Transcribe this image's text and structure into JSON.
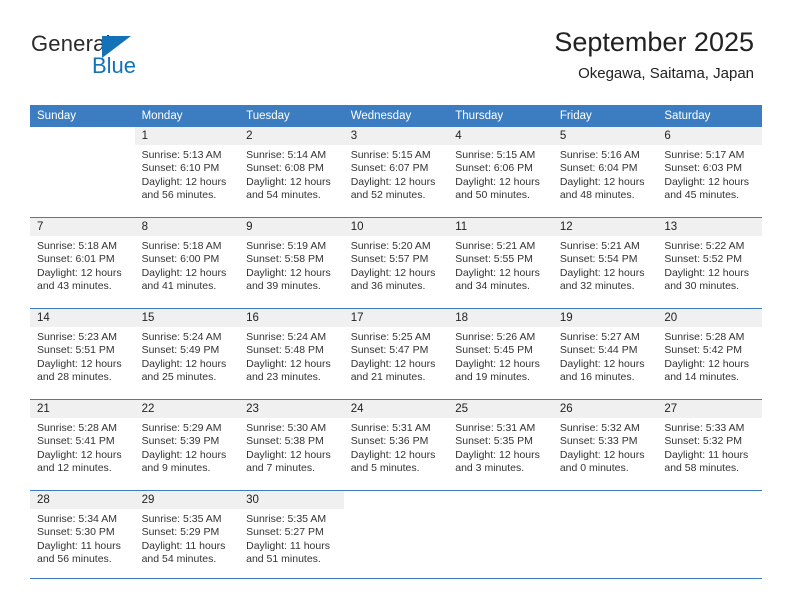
{
  "brand": {
    "name_top": "General",
    "name_bottom": "Blue",
    "triangle_icon": "triangle-icon",
    "color_dark": "#2b2b2b",
    "color_blue": "#1473b8"
  },
  "header": {
    "title": "September 2025",
    "subtitle": "Okegawa, Saitama, Japan"
  },
  "theme": {
    "header_row_bg": "#3b7dc0",
    "header_row_text": "#ffffff",
    "daynum_bg": "#f0f0f0",
    "grid_line": "#3b7dc0",
    "body_text": "#333333"
  },
  "weekdays": [
    "Sunday",
    "Monday",
    "Tuesday",
    "Wednesday",
    "Thursday",
    "Friday",
    "Saturday"
  ],
  "weeks": [
    [
      {
        "day": "",
        "empty": true,
        "sunrise": "",
        "sunset": "",
        "daylight_line1": "",
        "daylight_line2": ""
      },
      {
        "day": "1",
        "sunrise": "Sunrise: 5:13 AM",
        "sunset": "Sunset: 6:10 PM",
        "daylight_line1": "Daylight: 12 hours",
        "daylight_line2": "and 56 minutes."
      },
      {
        "day": "2",
        "sunrise": "Sunrise: 5:14 AM",
        "sunset": "Sunset: 6:08 PM",
        "daylight_line1": "Daylight: 12 hours",
        "daylight_line2": "and 54 minutes."
      },
      {
        "day": "3",
        "sunrise": "Sunrise: 5:15 AM",
        "sunset": "Sunset: 6:07 PM",
        "daylight_line1": "Daylight: 12 hours",
        "daylight_line2": "and 52 minutes."
      },
      {
        "day": "4",
        "sunrise": "Sunrise: 5:15 AM",
        "sunset": "Sunset: 6:06 PM",
        "daylight_line1": "Daylight: 12 hours",
        "daylight_line2": "and 50 minutes."
      },
      {
        "day": "5",
        "sunrise": "Sunrise: 5:16 AM",
        "sunset": "Sunset: 6:04 PM",
        "daylight_line1": "Daylight: 12 hours",
        "daylight_line2": "and 48 minutes."
      },
      {
        "day": "6",
        "sunrise": "Sunrise: 5:17 AM",
        "sunset": "Sunset: 6:03 PM",
        "daylight_line1": "Daylight: 12 hours",
        "daylight_line2": "and 45 minutes."
      }
    ],
    [
      {
        "day": "7",
        "sunrise": "Sunrise: 5:18 AM",
        "sunset": "Sunset: 6:01 PM",
        "daylight_line1": "Daylight: 12 hours",
        "daylight_line2": "and 43 minutes."
      },
      {
        "day": "8",
        "sunrise": "Sunrise: 5:18 AM",
        "sunset": "Sunset: 6:00 PM",
        "daylight_line1": "Daylight: 12 hours",
        "daylight_line2": "and 41 minutes."
      },
      {
        "day": "9",
        "sunrise": "Sunrise: 5:19 AM",
        "sunset": "Sunset: 5:58 PM",
        "daylight_line1": "Daylight: 12 hours",
        "daylight_line2": "and 39 minutes."
      },
      {
        "day": "10",
        "sunrise": "Sunrise: 5:20 AM",
        "sunset": "Sunset: 5:57 PM",
        "daylight_line1": "Daylight: 12 hours",
        "daylight_line2": "and 36 minutes."
      },
      {
        "day": "11",
        "sunrise": "Sunrise: 5:21 AM",
        "sunset": "Sunset: 5:55 PM",
        "daylight_line1": "Daylight: 12 hours",
        "daylight_line2": "and 34 minutes."
      },
      {
        "day": "12",
        "sunrise": "Sunrise: 5:21 AM",
        "sunset": "Sunset: 5:54 PM",
        "daylight_line1": "Daylight: 12 hours",
        "daylight_line2": "and 32 minutes."
      },
      {
        "day": "13",
        "sunrise": "Sunrise: 5:22 AM",
        "sunset": "Sunset: 5:52 PM",
        "daylight_line1": "Daylight: 12 hours",
        "daylight_line2": "and 30 minutes."
      }
    ],
    [
      {
        "day": "14",
        "sunrise": "Sunrise: 5:23 AM",
        "sunset": "Sunset: 5:51 PM",
        "daylight_line1": "Daylight: 12 hours",
        "daylight_line2": "and 28 minutes."
      },
      {
        "day": "15",
        "sunrise": "Sunrise: 5:24 AM",
        "sunset": "Sunset: 5:49 PM",
        "daylight_line1": "Daylight: 12 hours",
        "daylight_line2": "and 25 minutes."
      },
      {
        "day": "16",
        "sunrise": "Sunrise: 5:24 AM",
        "sunset": "Sunset: 5:48 PM",
        "daylight_line1": "Daylight: 12 hours",
        "daylight_line2": "and 23 minutes."
      },
      {
        "day": "17",
        "sunrise": "Sunrise: 5:25 AM",
        "sunset": "Sunset: 5:47 PM",
        "daylight_line1": "Daylight: 12 hours",
        "daylight_line2": "and 21 minutes."
      },
      {
        "day": "18",
        "sunrise": "Sunrise: 5:26 AM",
        "sunset": "Sunset: 5:45 PM",
        "daylight_line1": "Daylight: 12 hours",
        "daylight_line2": "and 19 minutes."
      },
      {
        "day": "19",
        "sunrise": "Sunrise: 5:27 AM",
        "sunset": "Sunset: 5:44 PM",
        "daylight_line1": "Daylight: 12 hours",
        "daylight_line2": "and 16 minutes."
      },
      {
        "day": "20",
        "sunrise": "Sunrise: 5:28 AM",
        "sunset": "Sunset: 5:42 PM",
        "daylight_line1": "Daylight: 12 hours",
        "daylight_line2": "and 14 minutes."
      }
    ],
    [
      {
        "day": "21",
        "sunrise": "Sunrise: 5:28 AM",
        "sunset": "Sunset: 5:41 PM",
        "daylight_line1": "Daylight: 12 hours",
        "daylight_line2": "and 12 minutes."
      },
      {
        "day": "22",
        "sunrise": "Sunrise: 5:29 AM",
        "sunset": "Sunset: 5:39 PM",
        "daylight_line1": "Daylight: 12 hours",
        "daylight_line2": "and 9 minutes."
      },
      {
        "day": "23",
        "sunrise": "Sunrise: 5:30 AM",
        "sunset": "Sunset: 5:38 PM",
        "daylight_line1": "Daylight: 12 hours",
        "daylight_line2": "and 7 minutes."
      },
      {
        "day": "24",
        "sunrise": "Sunrise: 5:31 AM",
        "sunset": "Sunset: 5:36 PM",
        "daylight_line1": "Daylight: 12 hours",
        "daylight_line2": "and 5 minutes."
      },
      {
        "day": "25",
        "sunrise": "Sunrise: 5:31 AM",
        "sunset": "Sunset: 5:35 PM",
        "daylight_line1": "Daylight: 12 hours",
        "daylight_line2": "and 3 minutes."
      },
      {
        "day": "26",
        "sunrise": "Sunrise: 5:32 AM",
        "sunset": "Sunset: 5:33 PM",
        "daylight_line1": "Daylight: 12 hours",
        "daylight_line2": "and 0 minutes."
      },
      {
        "day": "27",
        "sunrise": "Sunrise: 5:33 AM",
        "sunset": "Sunset: 5:32 PM",
        "daylight_line1": "Daylight: 11 hours",
        "daylight_line2": "and 58 minutes."
      }
    ],
    [
      {
        "day": "28",
        "sunrise": "Sunrise: 5:34 AM",
        "sunset": "Sunset: 5:30 PM",
        "daylight_line1": "Daylight: 11 hours",
        "daylight_line2": "and 56 minutes."
      },
      {
        "day": "29",
        "sunrise": "Sunrise: 5:35 AM",
        "sunset": "Sunset: 5:29 PM",
        "daylight_line1": "Daylight: 11 hours",
        "daylight_line2": "and 54 minutes."
      },
      {
        "day": "30",
        "sunrise": "Sunrise: 5:35 AM",
        "sunset": "Sunset: 5:27 PM",
        "daylight_line1": "Daylight: 11 hours",
        "daylight_line2": "and 51 minutes."
      },
      {
        "day": "",
        "empty": true,
        "sunrise": "",
        "sunset": "",
        "daylight_line1": "",
        "daylight_line2": ""
      },
      {
        "day": "",
        "empty": true,
        "sunrise": "",
        "sunset": "",
        "daylight_line1": "",
        "daylight_line2": ""
      },
      {
        "day": "",
        "empty": true,
        "sunrise": "",
        "sunset": "",
        "daylight_line1": "",
        "daylight_line2": ""
      },
      {
        "day": "",
        "empty": true,
        "sunrise": "",
        "sunset": "",
        "daylight_line1": "",
        "daylight_line2": ""
      }
    ]
  ]
}
